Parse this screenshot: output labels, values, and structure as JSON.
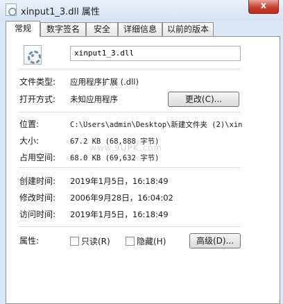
{
  "window": {
    "title": "xinput1_3.dll 属性",
    "close_label": "x"
  },
  "tabs": [
    {
      "label": "常规"
    },
    {
      "label": "数字签名"
    },
    {
      "label": "安全"
    },
    {
      "label": "详细信息"
    },
    {
      "label": "以前的版本"
    }
  ],
  "general": {
    "file_name": "xinput1_3.dll",
    "file_type_label": "文件类型:",
    "file_type_value": "应用程序扩展 (.dll)",
    "open_with_label": "打开方式:",
    "open_with_value": "未知应用程序",
    "change_button": "更改(C)...",
    "location_label": "位置:",
    "location_value": "C:\\Users\\admin\\Desktop\\新建文件夹 (2)\\xin",
    "size_label": "大小:",
    "size_value": "67.2 KB (68,888 字节)",
    "size_on_disk_label": "占用空间:",
    "size_on_disk_value": "68.0 KB (69,632 字节)",
    "watermark": "www.9UPK.com",
    "created_label": "创建时间:",
    "created_value": "2019年1月5日，16:18:49",
    "modified_label": "修改时间:",
    "modified_value": "2006年9月28日，16:04:02",
    "accessed_label": "访问时间:",
    "accessed_value": "2019年1月5日，16:18:49",
    "attributes_label": "属性:",
    "readonly_label": "只读(R)",
    "hidden_label": "隐藏(H)",
    "advanced_button": "高级(D)..."
  }
}
